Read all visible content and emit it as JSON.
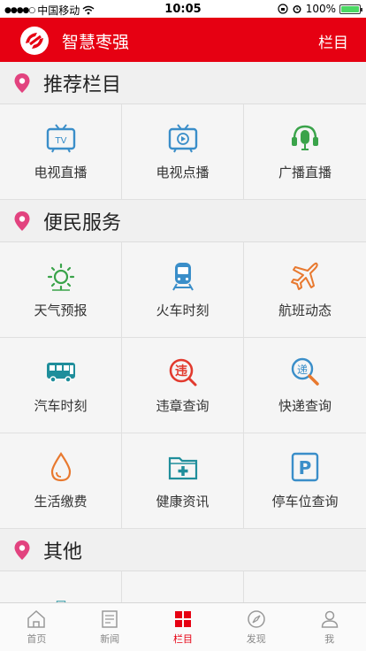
{
  "status_bar": {
    "carrier": "中国移动",
    "time": "10:05",
    "battery": "100%"
  },
  "header": {
    "title": "智慧枣强",
    "menu_label": "栏目"
  },
  "sections": [
    {
      "title": "推荐栏目",
      "items": [
        {
          "label": "电视直播",
          "icon": "tv-live-icon"
        },
        {
          "label": "电视点播",
          "icon": "tv-vod-icon"
        },
        {
          "label": "广播直播",
          "icon": "radio-mic-icon"
        }
      ]
    },
    {
      "title": "便民服务",
      "items": [
        {
          "label": "天气预报",
          "icon": "sun-icon"
        },
        {
          "label": "火车时刻",
          "icon": "train-icon"
        },
        {
          "label": "航班动态",
          "icon": "airplane-icon"
        },
        {
          "label": "汽车时刻",
          "icon": "bus-icon"
        },
        {
          "label": "违章查询",
          "icon": "violation-icon"
        },
        {
          "label": "快递查询",
          "icon": "express-search-icon"
        },
        {
          "label": "生活缴费",
          "icon": "water-drop-icon"
        },
        {
          "label": "健康资讯",
          "icon": "medical-folder-icon"
        },
        {
          "label": "停车位查询",
          "icon": "parking-icon"
        }
      ]
    },
    {
      "title": "其他"
    }
  ],
  "violation_icon_text": "违",
  "express_icon_text": "递",
  "parking_icon_text": "P",
  "tv_icon_text": "TV",
  "tabbar": [
    {
      "label": "首页",
      "icon": "home-icon",
      "active": false
    },
    {
      "label": "新闻",
      "icon": "news-icon",
      "active": false
    },
    {
      "label": "栏目",
      "icon": "grid-icon",
      "active": true
    },
    {
      "label": "发现",
      "icon": "compass-icon",
      "active": false
    },
    {
      "label": "我",
      "icon": "user-icon",
      "active": false
    }
  ],
  "colors": {
    "brand_red": "#e60012",
    "icon_blue": "#3a8ec9",
    "icon_green": "#3aa34a",
    "icon_orange": "#e8792f",
    "icon_teal": "#1f8e9b",
    "pin_pink": "#e2437f"
  }
}
